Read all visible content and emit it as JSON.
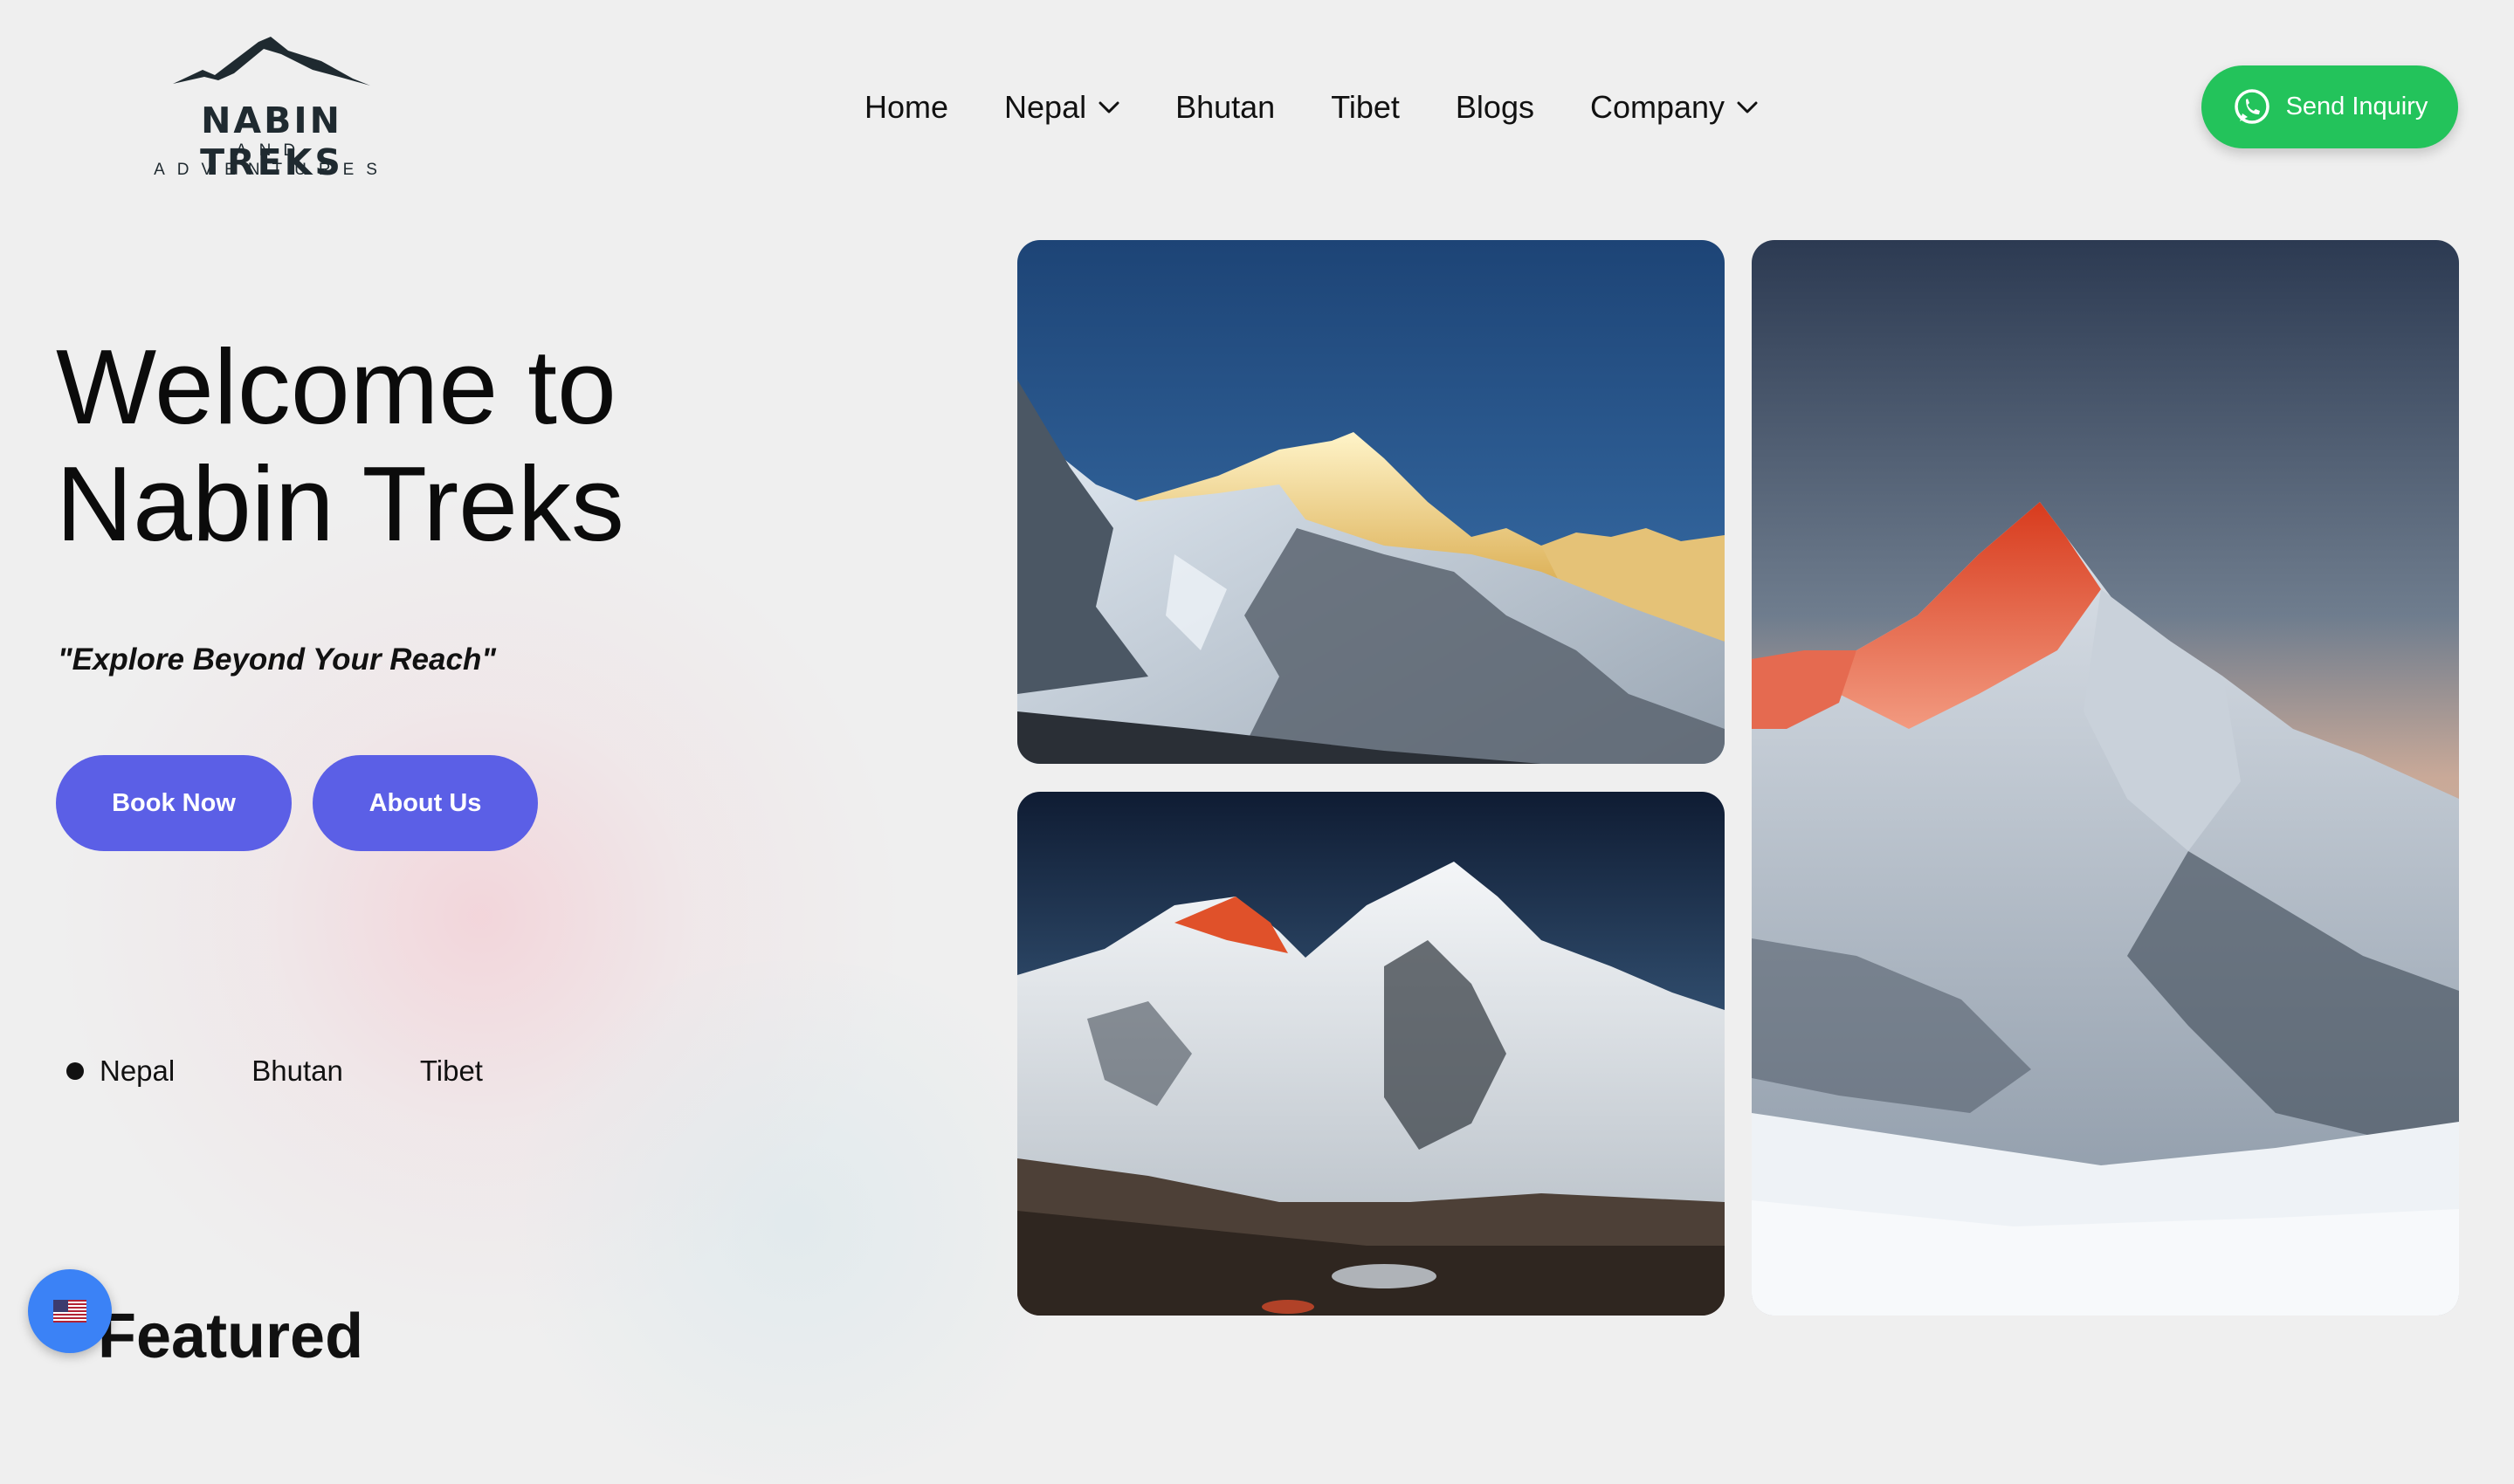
{
  "header": {
    "logo": {
      "name": "NABIN TREKS",
      "tagline": "AND ADVENTURES",
      "icon": "mountain-logo-icon"
    },
    "nav": [
      {
        "label": "Home",
        "dropdown": false
      },
      {
        "label": "Nepal",
        "dropdown": true
      },
      {
        "label": "Bhutan",
        "dropdown": false
      },
      {
        "label": "Tibet",
        "dropdown": false
      },
      {
        "label": "Blogs",
        "dropdown": false
      },
      {
        "label": "Company",
        "dropdown": true
      }
    ],
    "inquiry": {
      "label": "Send Inquiry",
      "icon": "whatsapp-icon",
      "color": "#23c35b"
    }
  },
  "hero": {
    "title_line1": "Welcome to",
    "title_line2": "Nabin Treks",
    "slogan": "\"Explore Beyond Your Reach\"",
    "buttons": {
      "book": "Book Now",
      "about": "About Us",
      "color": "#5b5fe6"
    },
    "destinations": [
      "Nepal",
      "Bhutan",
      "Tibet"
    ],
    "active_destination": "Nepal"
  },
  "gallery": [
    {
      "name": "sunlit-peak-photo"
    },
    {
      "name": "everest-range-photo"
    },
    {
      "name": "red-summit-photo"
    }
  ],
  "featured": {
    "heading": "Featured"
  },
  "language": {
    "icon": "us-flag-icon"
  }
}
